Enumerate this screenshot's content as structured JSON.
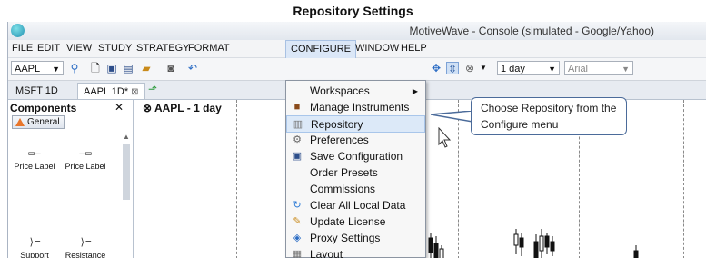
{
  "doc_title": "Repository Settings",
  "window": {
    "title": "MotiveWave - Console (simulated - Google/Yahoo)"
  },
  "menubar": [
    "FILE",
    "EDIT",
    "VIEW",
    "STUDY",
    "STRATEGY",
    "FORMAT",
    "CONFIGURE",
    "WINDOW",
    "HELP"
  ],
  "menubar_active": "CONFIGURE",
  "toolbar": {
    "symbol": "AAPL",
    "timeframe": "1 day",
    "font": "Arial"
  },
  "tabs": [
    {
      "label": "MSFT 1D"
    },
    {
      "label": "AAPL 1D*",
      "selected": true
    }
  ],
  "components": {
    "title": "Components",
    "group": "General",
    "items": [
      "Price Label",
      "Price Label",
      "Support",
      "Resistance"
    ]
  },
  "chart": {
    "label": "AAPL - 1 day"
  },
  "configure_menu": {
    "items": [
      {
        "label": "Workspaces",
        "icon": "none",
        "submenu": true
      },
      {
        "label": "Manage Instruments",
        "icon": "briefcase-icon"
      },
      {
        "label": "Repository",
        "icon": "server-icon",
        "hover": true
      },
      {
        "label": "Preferences",
        "icon": "gear-icon"
      },
      {
        "label": "Save Configuration",
        "icon": "floppy-icon"
      },
      {
        "label": "Order Presets",
        "icon": "none"
      },
      {
        "label": "Commissions",
        "icon": "none"
      },
      {
        "label": "Clear All Local Data",
        "icon": "refresh-icon"
      },
      {
        "label": "Update License",
        "icon": "license-icon"
      },
      {
        "label": "Proxy Settings",
        "icon": "network-icon"
      },
      {
        "label": "Layout",
        "icon": "layout-icon"
      }
    ]
  },
  "callout": {
    "text": "Choose Repository from the Configure menu"
  },
  "colors": {
    "accent": "#4b6b9a",
    "menu_hover": "#dce9f8",
    "title_bar": "#e2e7ee"
  }
}
